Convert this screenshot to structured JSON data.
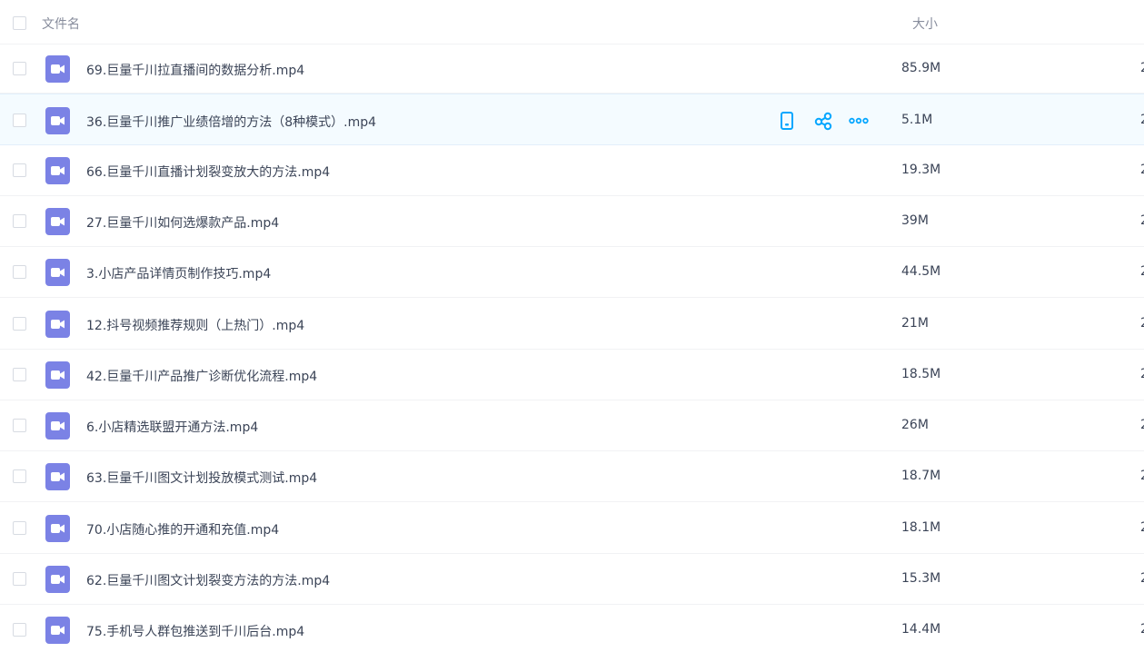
{
  "header": {
    "name_label": "文件名",
    "size_label": "大小"
  },
  "colors": {
    "accent": "#06a7ff",
    "video_icon": "#7b82e5",
    "hover_row": "#f4fbff"
  },
  "hover_actions": [
    "phone-icon",
    "share-icon",
    "more-icon"
  ],
  "files": [
    {
      "name": "69.巨量千川拉直播间的数据分析.mp4",
      "size": "85.9M",
      "trail": "2"
    },
    {
      "name": "36.巨量千川推广业绩倍增的方法（8种模式）.mp4",
      "size": "5.1M",
      "trail": "2"
    },
    {
      "name": "66.巨量千川直播计划裂变放大的方法.mp4",
      "size": "19.3M",
      "trail": "2"
    },
    {
      "name": "27.巨量千川如何选爆款产品.mp4",
      "size": "39M",
      "trail": "2"
    },
    {
      "name": "3.小店产品详情页制作技巧.mp4",
      "size": "44.5M",
      "trail": "2"
    },
    {
      "name": "12.抖号视频推荐规则（上热门）.mp4",
      "size": "21M",
      "trail": "2"
    },
    {
      "name": "42.巨量千川产品推广诊断优化流程.mp4",
      "size": "18.5M",
      "trail": "2"
    },
    {
      "name": "6.小店精选联盟开通方法.mp4",
      "size": "26M",
      "trail": "2"
    },
    {
      "name": "63.巨量千川图文计划投放模式测试.mp4",
      "size": "18.7M",
      "trail": "2"
    },
    {
      "name": "70.小店随心推的开通和充值.mp4",
      "size": "18.1M",
      "trail": "2"
    },
    {
      "name": "62.巨量千川图文计划裂变方法的方法.mp4",
      "size": "15.3M",
      "trail": "2"
    },
    {
      "name": "75.手机号人群包推送到千川后台.mp4",
      "size": "14.4M",
      "trail": "2"
    }
  ]
}
